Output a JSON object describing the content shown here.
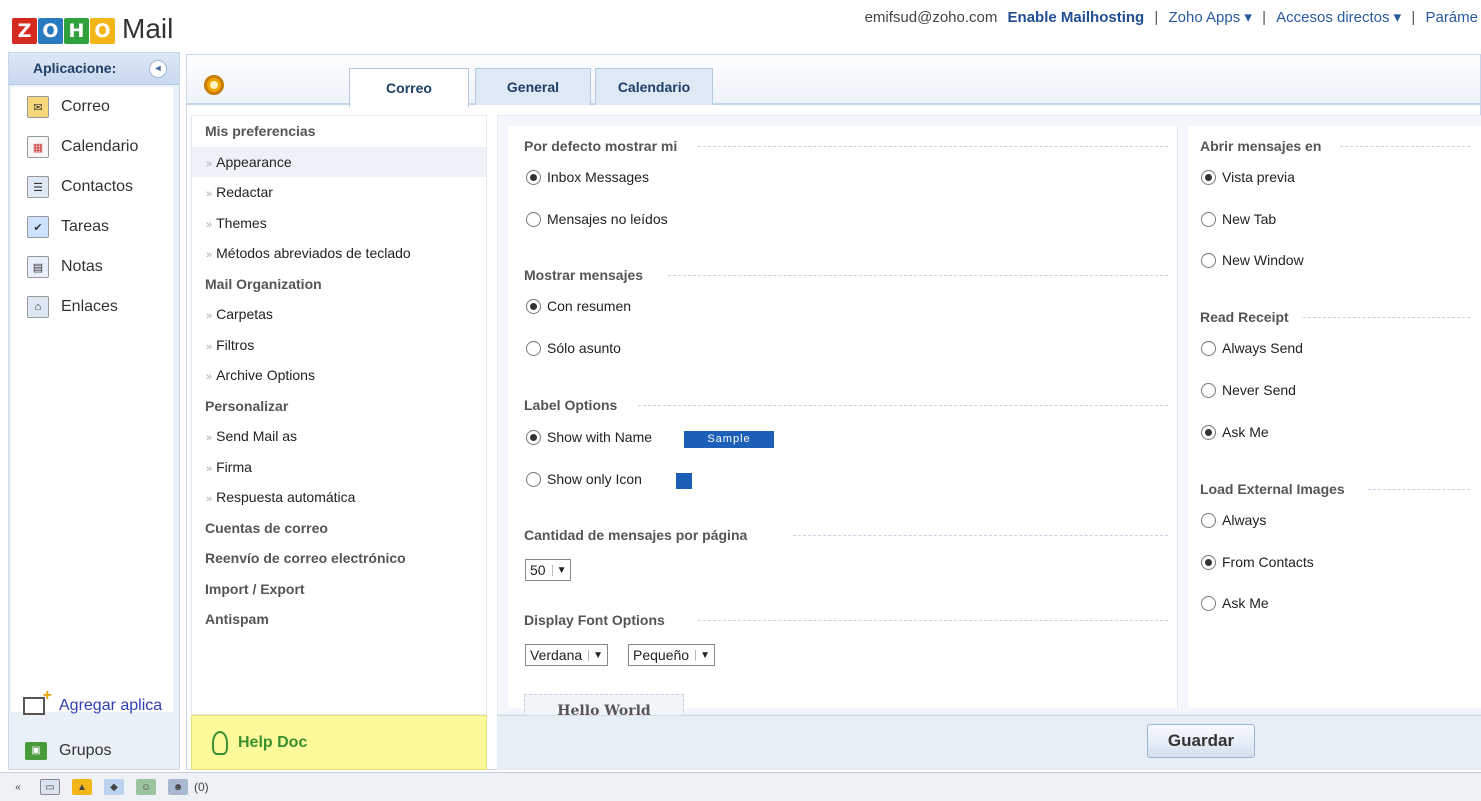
{
  "header": {
    "logo_letters": [
      "Z",
      "O",
      "H",
      "O"
    ],
    "logo_product": "Mail",
    "email": "emifsud@zoho.com",
    "enable_link": "Enable Mailhosting",
    "separator": "|",
    "zoho_apps": "Zoho Apps ▾",
    "shortcuts": "Accesos directos ▾",
    "params": "Paráme"
  },
  "apps": {
    "title": "Aplicacione:",
    "collapse_glyph": "◂",
    "items": [
      {
        "label": "Correo",
        "icon": "mail-icon"
      },
      {
        "label": "Calendario",
        "icon": "calendar-icon"
      },
      {
        "label": "Contactos",
        "icon": "contacts-icon"
      },
      {
        "label": "Tareas",
        "icon": "tasks-icon"
      },
      {
        "label": "Notas",
        "icon": "notes-icon"
      },
      {
        "label": "Enlaces",
        "icon": "links-icon"
      }
    ],
    "add_app": "Agregar aplica",
    "groups": "Grupos"
  },
  "tabs": {
    "correo": "Correo",
    "general": "General",
    "calendario": "Calendario"
  },
  "prefnav": {
    "mis_preferencias": "Mis preferencias",
    "appearance": "Appearance",
    "redactar": "Redactar",
    "themes": "Themes",
    "metodos": "Métodos abreviados de teclado",
    "mail_org": "Mail Organization",
    "carpetas": "Carpetas",
    "filtros": "Filtros",
    "archive": "Archive Options",
    "personalizar": "Personalizar",
    "send_mail_as": "Send Mail as",
    "firma": "Firma",
    "respuesta": "Respuesta automática",
    "cuentas": "Cuentas de correo",
    "reenvio": "Reenvío de correo electrónico",
    "import_export": "Import / Export",
    "antispam": "Antispam",
    "arrow": "»"
  },
  "helpdoc": "Help Doc",
  "settings": {
    "default_show": {
      "title": "Por defecto mostrar mi",
      "opt1": "Inbox Messages",
      "opt2": "Mensajes no leídos",
      "selected": "Inbox Messages"
    },
    "show_messages": {
      "title": "Mostrar mensajes",
      "opt1": "Con resumen",
      "opt2": "Sólo asunto",
      "selected": "Con resumen"
    },
    "label_options": {
      "title": "Label Options",
      "opt1": "Show with Name",
      "sample": "Sample",
      "opt2": "Show only Icon",
      "selected": "Show with Name"
    },
    "per_page": {
      "title": "Cantidad de mensajes por página",
      "value": "50"
    },
    "font_options": {
      "title": "Display Font Options",
      "font": "Verdana",
      "size": "Pequeño",
      "preview": "Hello World"
    },
    "open_in": {
      "title": "Abrir mensajes en",
      "opt1": "Vista previa",
      "opt2": "New Tab",
      "opt3": "New Window",
      "selected": "Vista previa"
    },
    "read_receipt": {
      "title": "Read Receipt",
      "opt1": "Always Send",
      "opt2": "Never Send",
      "opt3": "Ask Me",
      "selected": "Ask Me"
    },
    "external_images": {
      "title": "Load External Images",
      "opt1": "Always",
      "opt2": "From Contacts",
      "opt3": "Ask Me",
      "selected": "From Contacts"
    }
  },
  "save_button": "Guardar",
  "statusbar": {
    "collapse": "«",
    "count": "(0)"
  },
  "colors": {
    "accent": "#1b5fb8",
    "help_bg": "#fdfa9c",
    "link": "#2a5a9e"
  }
}
